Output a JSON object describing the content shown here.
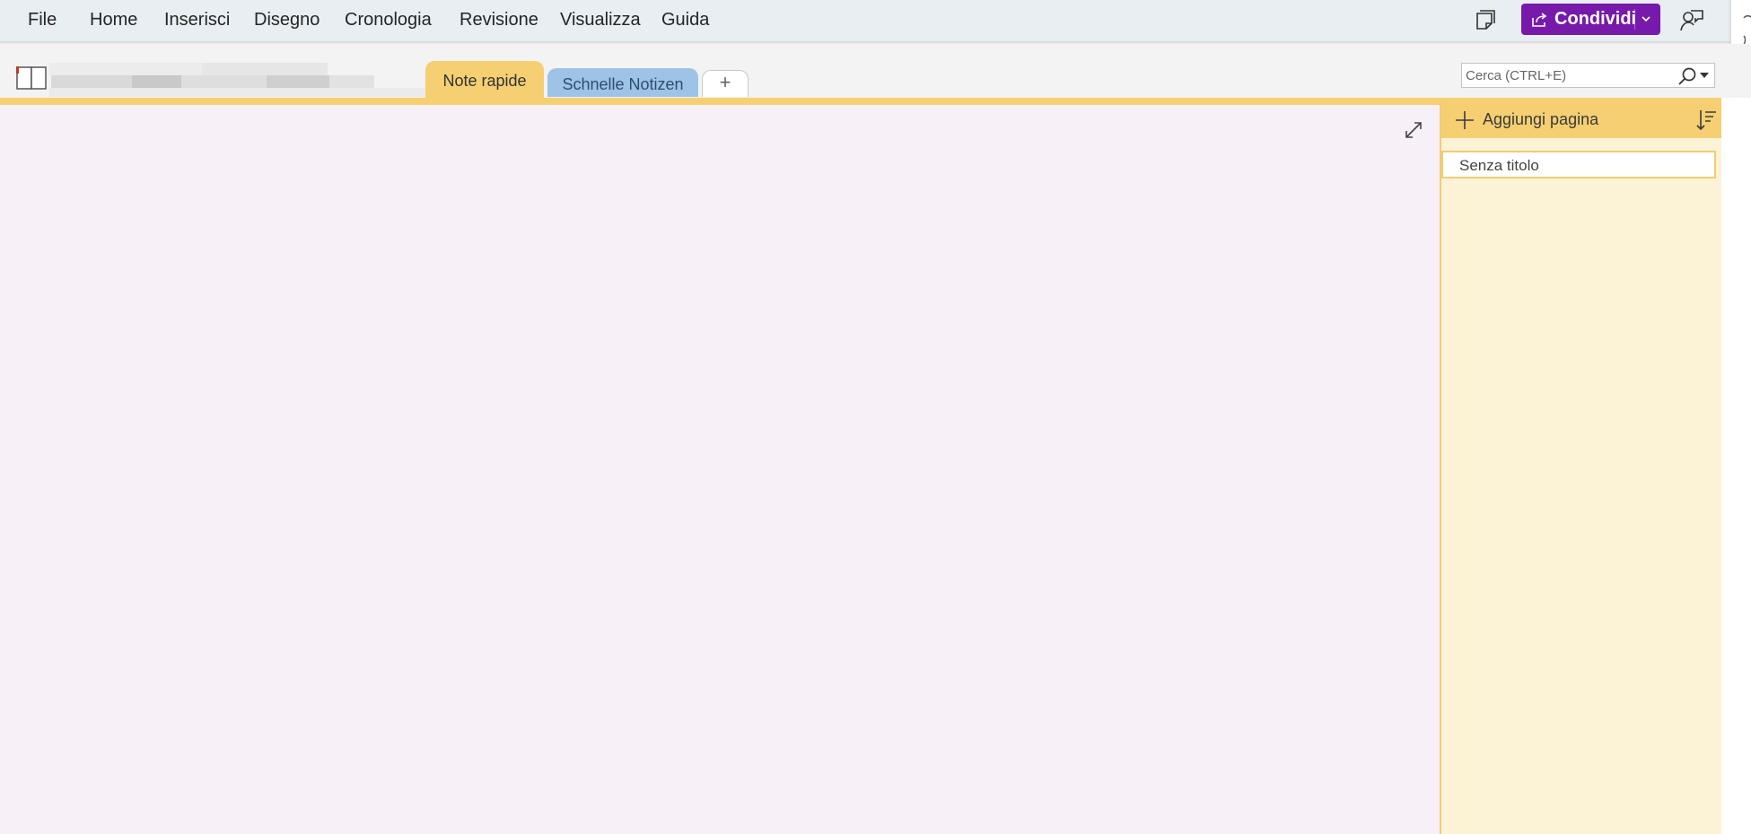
{
  "menu": {
    "items": [
      "File",
      "Home",
      "Inserisci",
      "Disegno",
      "Cronologia",
      "Revisione",
      "Visualizza",
      "Guida"
    ]
  },
  "toolbar": {
    "share_label": "Condividi",
    "accent_color": "#7719aa",
    "icons": [
      "sticky-note-icon",
      "share-icon",
      "chevron-down-icon",
      "feedback-icon"
    ]
  },
  "notebook": {
    "name_redacted": true
  },
  "sections": {
    "tabs": [
      {
        "label": "Note rapide",
        "color": "#f5cf72",
        "active": true
      },
      {
        "label": "Schnelle Notizen",
        "color": "#9dc3e6",
        "active": false
      }
    ],
    "add_label": "+"
  },
  "search": {
    "placeholder": "Cerca (CTRL+E)"
  },
  "pages": {
    "add_label": "Aggiungi pagina",
    "items": [
      {
        "label": "Senza titolo"
      }
    ]
  },
  "colors": {
    "section_yellow": "#f5cf72",
    "canvas_bg": "#f7f0f7",
    "pane_bg": "#fcf2d6"
  }
}
